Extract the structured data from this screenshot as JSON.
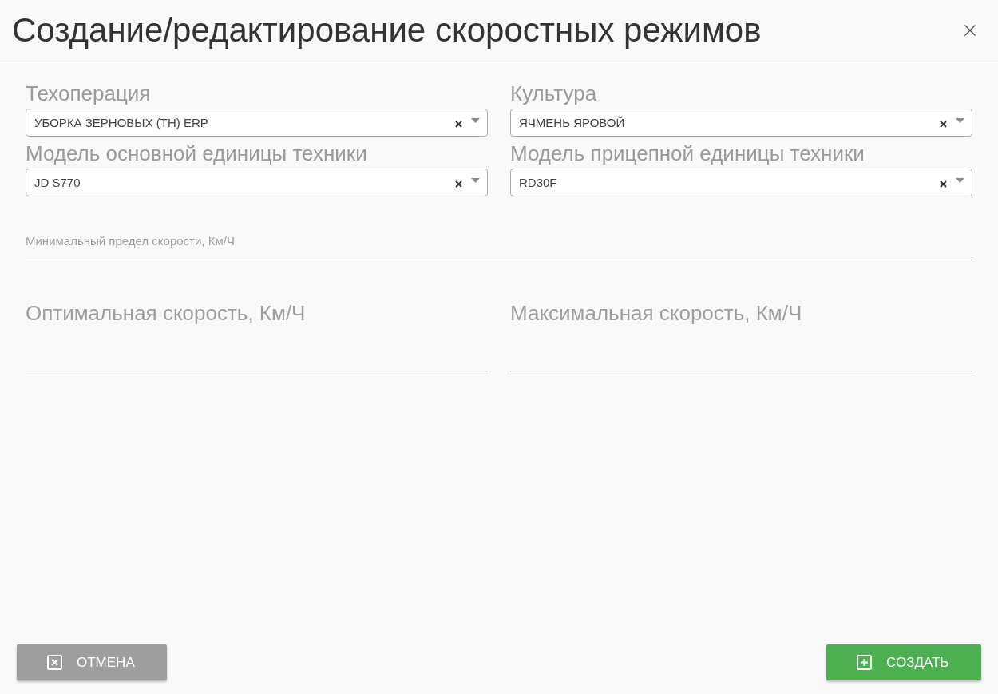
{
  "dialog": {
    "title": "Создание/редактирование скоростных режимов"
  },
  "selects": [
    {
      "label": "Техоперация",
      "value": "УБОРКА ЗЕРНОВЫХ (TH) ERP"
    },
    {
      "label": "Культура",
      "value": "ЯЧМЕНЬ ЯРОВОЙ"
    },
    {
      "label": "Модель основной единицы техники",
      "value": "JD S770"
    },
    {
      "label": "Модель прицепной единицы техники",
      "value": "RD30F"
    }
  ],
  "speed_fields": [
    {
      "label": "Минимальный предел скорости, Км/Ч",
      "kind": "floated"
    },
    {
      "label": "Оптимальная скорость, Км/Ч",
      "kind": "resting"
    },
    {
      "label": "Максимальная скорость, Км/Ч",
      "kind": "resting"
    }
  ],
  "buttons": [
    {
      "label": "ОТМЕНА",
      "kind": "cancel"
    },
    {
      "label": "СОЗДАТЬ",
      "kind": "create"
    }
  ]
}
